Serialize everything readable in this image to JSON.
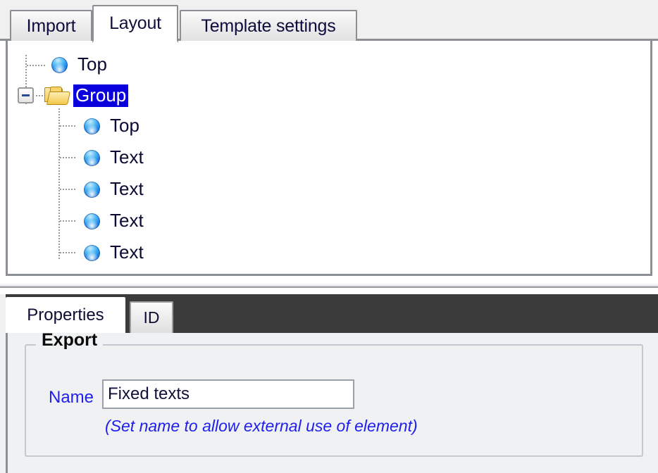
{
  "top_panel": {
    "tabs": [
      {
        "id": "import",
        "label": "Import",
        "selected": false
      },
      {
        "id": "layout",
        "label": "Layout",
        "selected": true
      },
      {
        "id": "template-settings",
        "label": "Template settings",
        "selected": false
      }
    ],
    "tree": {
      "nodes": [
        {
          "label": "Top",
          "icon": "blue-sphere-icon",
          "level": 1,
          "selected": false,
          "expander": null
        },
        {
          "label": "Group",
          "icon": "open-folder-icon",
          "level": 0,
          "selected": true,
          "expander": "minus"
        },
        {
          "label": "Top",
          "icon": "blue-sphere-icon",
          "level": 2,
          "selected": false,
          "expander": null
        },
        {
          "label": "Text",
          "icon": "blue-sphere-icon",
          "level": 2,
          "selected": false,
          "expander": null
        },
        {
          "label": "Text",
          "icon": "blue-sphere-icon",
          "level": 2,
          "selected": false,
          "expander": null
        },
        {
          "label": "Text",
          "icon": "blue-sphere-icon",
          "level": 2,
          "selected": false,
          "expander": null
        },
        {
          "label": "Text",
          "icon": "blue-sphere-icon",
          "level": 2,
          "selected": false,
          "expander": null
        }
      ],
      "selection_color": "#0a00dd",
      "selection_text_color": "#ffffff"
    }
  },
  "bottom_panel": {
    "tabs": [
      {
        "id": "properties",
        "label": "Properties",
        "selected": true
      },
      {
        "id": "id",
        "label": "ID",
        "selected": false
      }
    ],
    "tabstrip_background": "#3b3b3b",
    "export_group": {
      "legend": "Export",
      "name_label": "Name",
      "name_value": "Fixed texts",
      "name_placeholder": "",
      "hint": "(Set name to allow external use of element)",
      "label_color": "#2020ee",
      "hint_color": "#2020ee"
    }
  }
}
